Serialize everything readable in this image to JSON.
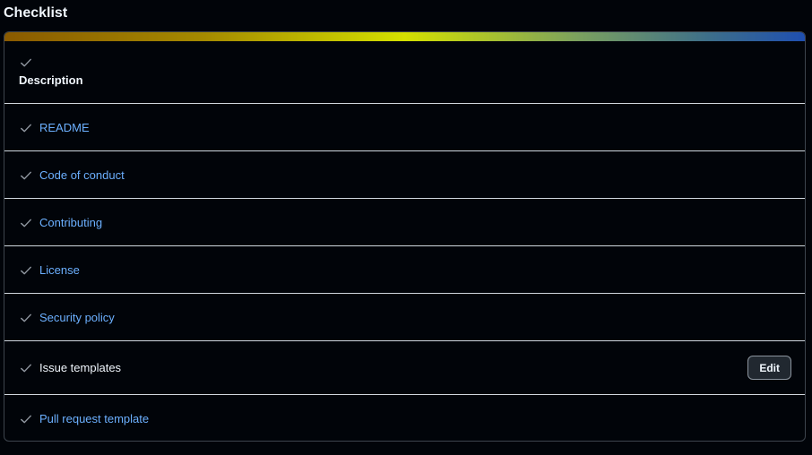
{
  "title": "Checklist",
  "progress_colors": [
    "#8a5a00",
    "#d4e000",
    "#1f4fb0"
  ],
  "description": {
    "label": "Description",
    "checked": true
  },
  "items": [
    {
      "label": "README",
      "checked": true,
      "link": true
    },
    {
      "label": "Code of conduct",
      "checked": true,
      "link": true
    },
    {
      "label": "Contributing",
      "checked": true,
      "link": true
    },
    {
      "label": "License",
      "checked": true,
      "link": true
    },
    {
      "label": "Security policy",
      "checked": true,
      "link": true
    },
    {
      "label": "Issue templates",
      "checked": true,
      "link": false,
      "action_label": "Edit"
    },
    {
      "label": "Pull request template",
      "checked": true,
      "link": true
    }
  ],
  "icons": {
    "check": "check-icon"
  }
}
